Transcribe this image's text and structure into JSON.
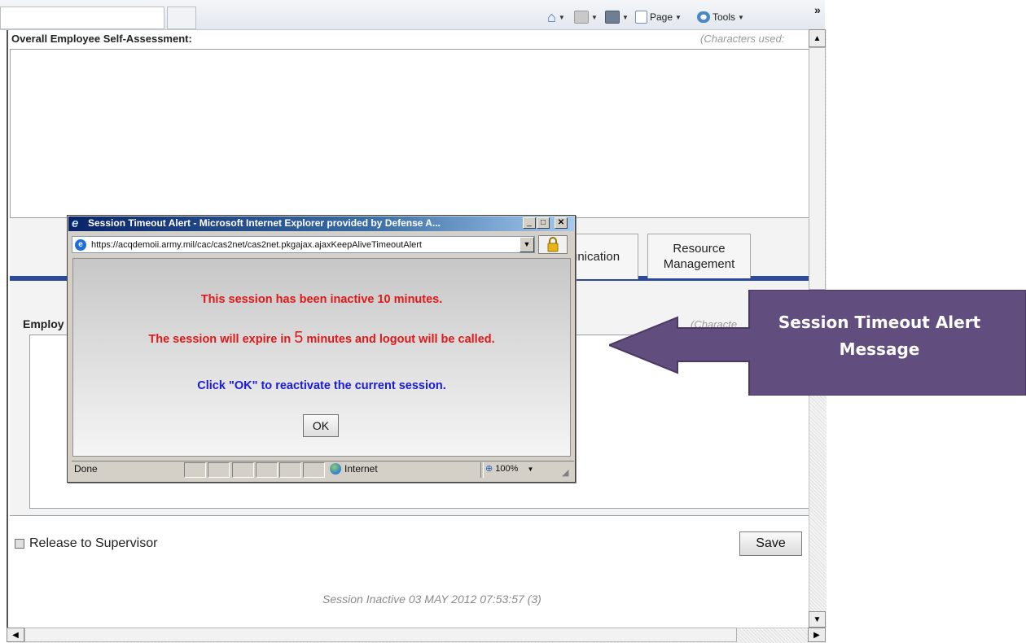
{
  "toolbar": {
    "home_glyph": "⌂",
    "page_label": "Page",
    "tools_label": "Tools",
    "more_glyph": "»"
  },
  "form": {
    "self_assessment_label": "Overall Employee Self-Assessment:",
    "characters_used_1": "(Characters used:",
    "tab_communication": "unication",
    "tab_resource_line1": "Resource",
    "tab_resource_line2": "Management",
    "employee_label": "Employ",
    "characters_used_2": "(Characte",
    "release_label": "Release to Supervisor",
    "save_label": "Save",
    "session_inactive": "Session Inactive 03 MAY 2012 07:53:57 (3)"
  },
  "popup": {
    "title": "Session Timeout Alert - Microsoft Internet Explorer provided by Defense A...",
    "address": "https://acqdemoii.army.mil/cac/cas2net/cas2net.pkgajax.ajaxKeepAliveTimeoutAlert",
    "msg_line1": "This session has been inactive 10 minutes.",
    "msg_line2_pre": "The session will expire in ",
    "msg_line2_num": "5",
    "msg_line2_post": " minutes and logout will be called.",
    "msg_line3": "Click \"OK\" to reactivate the current session.",
    "ok_label": "OK",
    "status_text": "Done",
    "zone_text": "Internet",
    "zoom_text": "100%"
  },
  "callout": {
    "line1": "Session Timeout Alert",
    "line2": "Message"
  },
  "colors": {
    "callout_purple": "#614d7e",
    "alert_red": "#e01818",
    "alert_blue": "#1a1ad8",
    "tab_bar_blue": "#2b4a9b"
  }
}
